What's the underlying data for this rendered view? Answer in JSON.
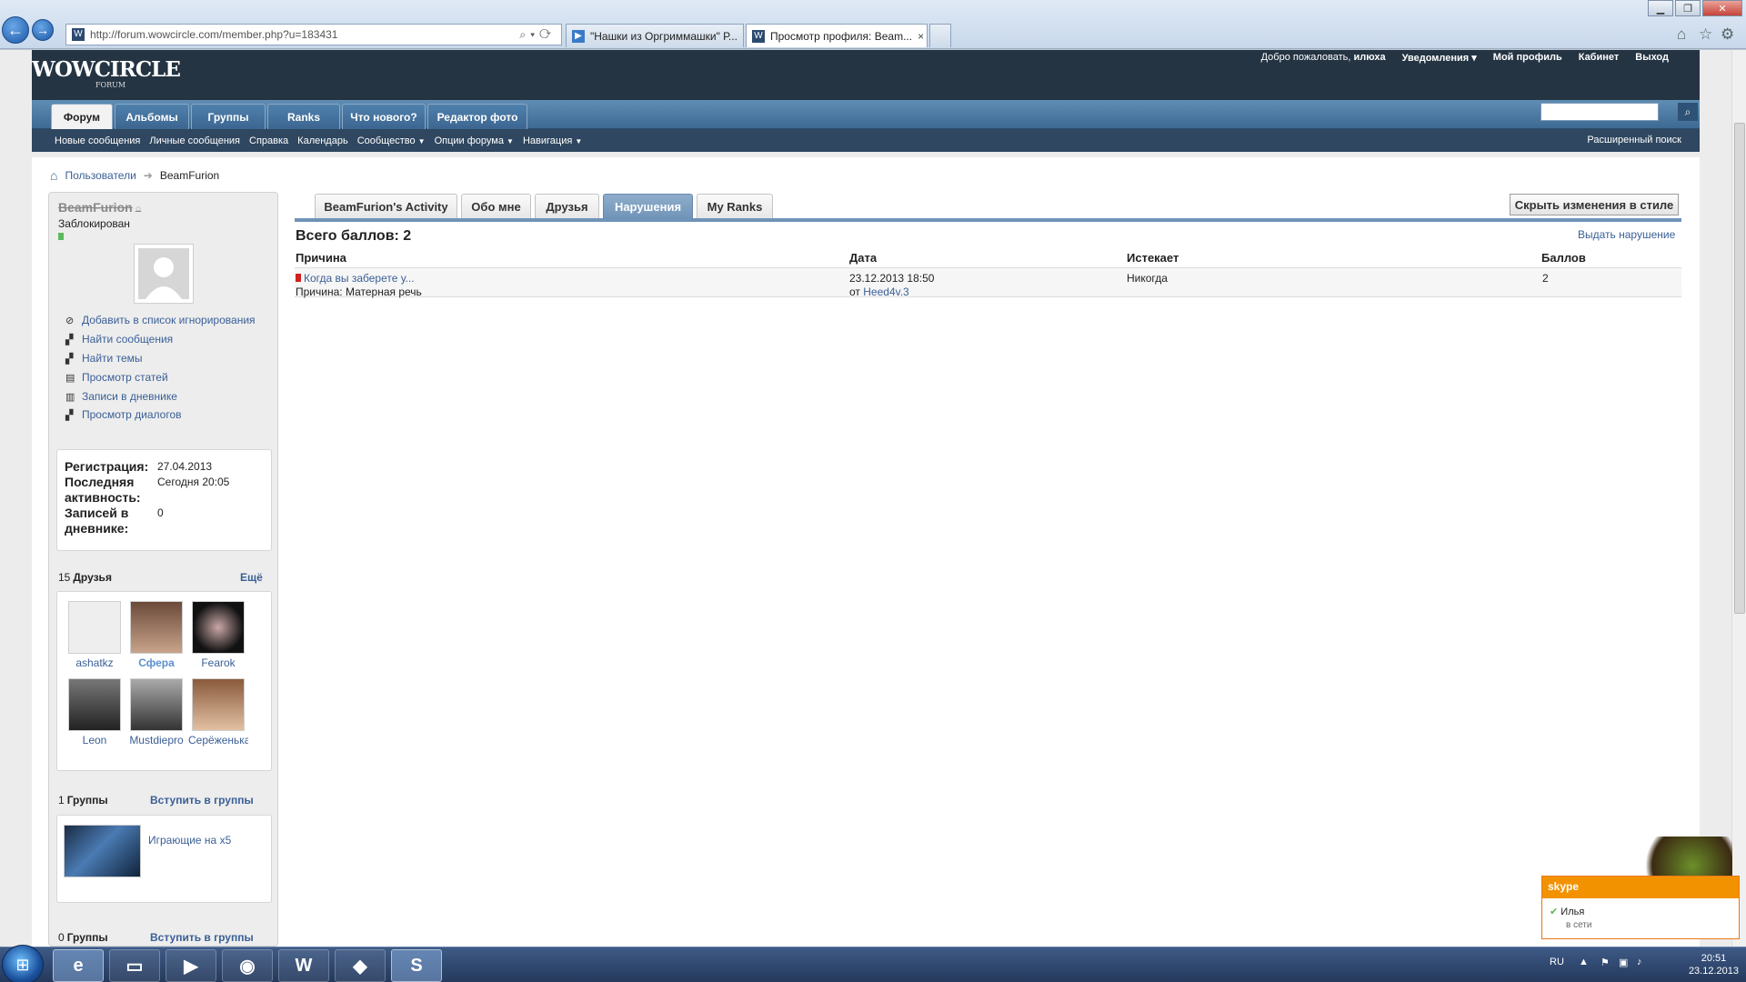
{
  "browser": {
    "url": "http://forum.wowcircle.com/member.php?u=183431",
    "tabs": [
      {
        "label": "\"Нашки из Оргриммашки\" Р..."
      },
      {
        "label": "Просмотр профиля: Beam..."
      }
    ],
    "close_glyph": "×"
  },
  "forum": {
    "logo": "WOWCIRCLE",
    "logo_sub": "FORUM",
    "top_links": {
      "welcome": "Добро пожаловать,",
      "user": "илюха",
      "notifications": "Уведомления ▾",
      "my_profile": "Мой профиль",
      "cabinet": "Кабинет",
      "logout": "Выход"
    },
    "nav_tabs": [
      "Форум",
      "Альбомы",
      "Группы",
      "Ranks",
      "Что нового?",
      "Редактор фото"
    ],
    "sub_nav": [
      "Новые сообщения",
      "Личные сообщения",
      "Справка",
      "Календарь",
      "Сообщество",
      "Опции форума",
      "Навигация"
    ],
    "advanced_search": "Расширенный поиск",
    "breadcrumb": {
      "users": "Пользователи",
      "current": "BeamFurion"
    }
  },
  "profile": {
    "username": "BeamFurion",
    "status": "Заблокирован",
    "actions": [
      "Добавить в список игнорирования",
      "Найти сообщения",
      "Найти темы",
      "Просмотр статей",
      "Записи в дневнике",
      "Просмотр диалогов"
    ],
    "stats": {
      "reg_label": "Регистрация:",
      "reg_value": "27.04.2013",
      "last_label": "Последняя активность:",
      "last_value": "Сегодня 20:05",
      "diary_label": "Записей в дневнике:",
      "diary_value": "0"
    },
    "friends": {
      "count": "15",
      "title": "Друзья",
      "more": "Ещё",
      "list": [
        "ashatkz",
        "Сфера",
        "Fearok",
        "Leon",
        "Mustdiepro",
        "Серёженька"
      ]
    },
    "groups": {
      "count": "1",
      "title": "Группы",
      "join": "Вступить в группы",
      "item": "Играющие на х5"
    },
    "groups2": {
      "count": "0",
      "title": "Группы",
      "join": "Вступить в группы"
    }
  },
  "main": {
    "tabs": [
      "BeamFurion's Activity",
      "Обо мне",
      "Друзья",
      "Нарушения",
      "My Ranks"
    ],
    "hide_changes": "Скрыть изменения в стиле",
    "total": "Всего баллов: 2",
    "issue_link": "Выдать нарушение",
    "columns": {
      "reason": "Причина",
      "date": "Дата",
      "expires": "Истекает",
      "points": "Баллов"
    },
    "row": {
      "title": "Когда вы заберете у...",
      "reason_label": "Причина:",
      "reason_text": "Матерная речь",
      "date": "23.12.2013 18:50",
      "by_label": "от",
      "by_user": "Heed4v.3",
      "expires": "Никогда",
      "points": "2"
    }
  },
  "taskbar": {
    "lang": "RU",
    "time": "20:51",
    "date": "23.12.2013"
  },
  "skype": {
    "brand": "skype",
    "user": "Илья",
    "status": "в сети"
  }
}
